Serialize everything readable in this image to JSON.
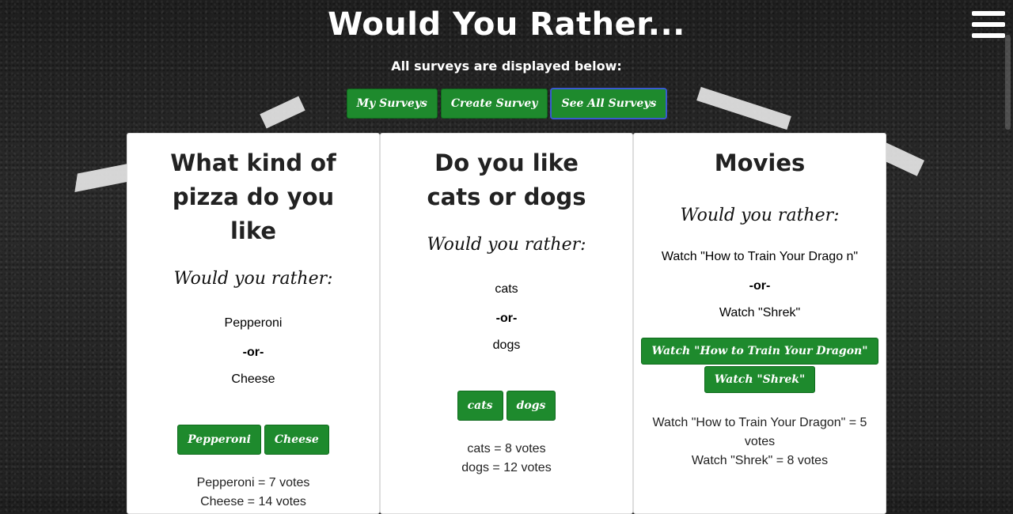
{
  "header": {
    "title": "Would You Rather...",
    "subtitle": "All surveys are displayed below:"
  },
  "nav": {
    "my_surveys": "My Surveys",
    "create_survey": "Create Survey",
    "see_all_surveys": "See All Surveys"
  },
  "surveys": [
    {
      "title": "What kind of pizza do you like",
      "prompt": "Would you rather:",
      "option_a": "Pepperoni",
      "or": "-or-",
      "option_b": "Cheese",
      "button_a": "Pepperoni",
      "button_b": "Cheese",
      "result_a": "Pepperoni = 7 votes",
      "result_b": "Cheese = 14 votes"
    },
    {
      "title": "Do you like cats or dogs",
      "prompt": "Would you rather:",
      "option_a": "cats",
      "or": "-or-",
      "option_b": "dogs",
      "button_a": "cats",
      "button_b": "dogs",
      "result_a": "cats = 8 votes",
      "result_b": "dogs = 12 votes"
    },
    {
      "title": "Movies",
      "prompt": "Would you rather:",
      "option_a": "Watch \"How to Train Your Drago n\"",
      "or": "-or-",
      "option_b": "Watch \"Shrek\"",
      "button_a": "Watch \"How to Train Your Dragon\"",
      "button_b": "Watch \"Shrek\"",
      "result_a": "Watch \"How to Train Your Dragon\" = 5 votes",
      "result_b": "Watch \"Shrek\" = 8 votes"
    }
  ]
}
